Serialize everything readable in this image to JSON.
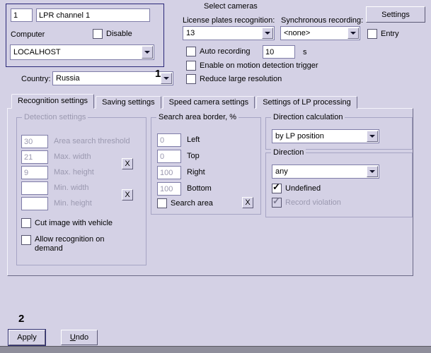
{
  "identity": {
    "id_value": "1",
    "name_value": "LPR channel 1",
    "computer_label": "Computer",
    "disable_label": "Disable",
    "disable_checked": false,
    "computer_value": "LOCALHOST"
  },
  "select_cameras": {
    "title": "Select cameras",
    "recognition_label": "License plates recognition:",
    "recognition_value": "13",
    "sync_label": "Synchronous recording:",
    "sync_value": "<none>",
    "settings_button": "Settings",
    "entry_label": "Entry",
    "entry_checked": false,
    "auto_recording_label": "Auto recording",
    "auto_recording_checked": false,
    "auto_recording_value": "10",
    "auto_recording_unit": "s",
    "motion_trigger_label": "Enable on motion detection trigger",
    "motion_trigger_checked": false,
    "reduce_resolution_label": "Reduce large resolution",
    "reduce_resolution_checked": false
  },
  "country": {
    "label": "Country:",
    "value": "Russia",
    "callout": "1"
  },
  "tabs": [
    {
      "label": "Recognition settings",
      "active": true
    },
    {
      "label": "Saving settings",
      "active": false
    },
    {
      "label": "Speed camera settings",
      "active": false
    },
    {
      "label": "Settings of LP processing",
      "active": false
    }
  ],
  "detection": {
    "title": "Detection settings",
    "threshold_value": "30",
    "threshold_label": "Area search threshold",
    "max_width_value": "21",
    "max_width_label": "Max. width",
    "max_height_value": "9",
    "max_height_label": "Max. height",
    "min_width_value": "",
    "min_width_label": "Min. width",
    "min_height_value": "",
    "min_height_label": "Min. height",
    "clear_max_button": "X",
    "clear_min_button": "X",
    "cut_image_label": "Cut image with vehicle",
    "cut_image_checked": false,
    "allow_demand_label": "Allow recognition on demand",
    "allow_demand_checked": false
  },
  "search_area": {
    "title": "Search area border, %",
    "left_value": "0",
    "left_label": "Left",
    "top_value": "0",
    "top_label": "Top",
    "right_value": "100",
    "right_label": "Right",
    "bottom_value": "100",
    "bottom_label": "Bottom",
    "checkbox_label": "Search area",
    "checkbox_checked": false,
    "clear_button": "X"
  },
  "direction": {
    "calc_title": "Direction calculation",
    "calc_value": "by LP position",
    "title": "Direction",
    "value": "any",
    "undefined_label": "Undefined",
    "undefined_checked": true,
    "record_violation_label": "Record violation",
    "record_violation_checked": true
  },
  "footer": {
    "callout": "2",
    "apply_button": "Apply",
    "undo_mnemonic": "U",
    "undo_rest": "ndo"
  }
}
